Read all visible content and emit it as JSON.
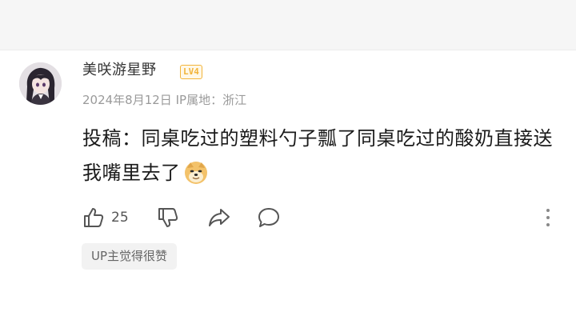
{
  "comment": {
    "username": "美咲游星野",
    "level_badge": "LV4",
    "date": "2024年8月12日",
    "ip_location": "IP属地：浙江",
    "content": "投稿：同桌吃过的塑料勺子瓢了同桌吃过的酸奶直接送我嘴里去了",
    "emoji": "doge-emoji",
    "like_count": "25",
    "up_tag": "UP主觉得很赞"
  },
  "icons": {
    "like": "thumbs-up-icon",
    "dislike": "thumbs-down-icon",
    "share": "share-arrow-icon",
    "reply": "reply-bubble-icon",
    "more": "more-vertical-icon"
  },
  "colors": {
    "level_badge": "#f2b43a",
    "text_primary": "#1a1a1a",
    "text_secondary": "#9a9a9a",
    "tag_bg": "#f2f2f2"
  }
}
